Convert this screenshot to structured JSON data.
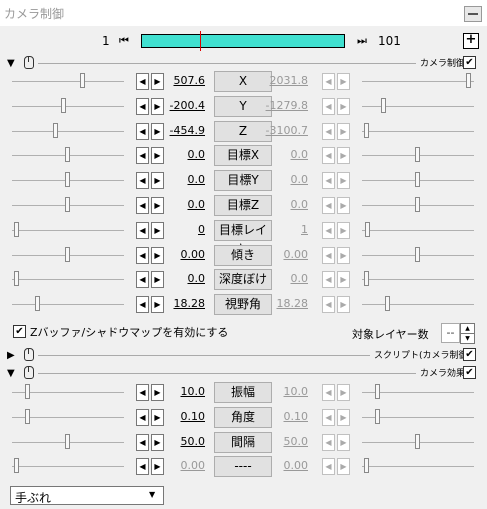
{
  "window": {
    "title": "カメラ制御",
    "minimize_icon": "minimize-icon"
  },
  "frame": {
    "start": "1",
    "end": "101",
    "first_icon": "skip-first-icon",
    "last_icon": "skip-last-icon",
    "add_label": "+"
  },
  "sections": {
    "camera_control": {
      "label": "カメラ制御",
      "checked": true
    },
    "script": {
      "label": "スクリプト(カメラ制御)",
      "checked": true
    },
    "camera_effect": {
      "label": "カメラ効果",
      "checked": true
    }
  },
  "arrows": {
    "left": "◀",
    "right": "▶"
  },
  "camera_params": [
    {
      "name": "X",
      "value": "507.6",
      "end_value": "2031.8",
      "left_pos": 0.64,
      "right_pos": 0.98
    },
    {
      "name": "Y",
      "value": "-200.4",
      "end_value": "-1279.8",
      "left_pos": 0.46,
      "right_pos": 0.18
    },
    {
      "name": "Z",
      "value": "-454.9",
      "end_value": "-3100.7",
      "left_pos": 0.39,
      "right_pos": 0.02
    },
    {
      "name": "目標X",
      "value": "0.0",
      "end_value": "0.0",
      "left_pos": 0.5,
      "right_pos": 0.5
    },
    {
      "name": "目標Y",
      "value": "0.0",
      "end_value": "0.0",
      "left_pos": 0.5,
      "right_pos": 0.5
    },
    {
      "name": "目標Z",
      "value": "0.0",
      "end_value": "0.0",
      "left_pos": 0.5,
      "right_pos": 0.5
    },
    {
      "name": "目標レイヤ",
      "value": "0",
      "end_value": "1",
      "left_pos": 0.02,
      "right_pos": 0.03
    },
    {
      "name": "傾き",
      "value": "0.00",
      "end_value": "0.00",
      "left_pos": 0.5,
      "right_pos": 0.5
    },
    {
      "name": "深度ぼけ",
      "value": "0.0",
      "end_value": "0.0",
      "left_pos": 0.02,
      "right_pos": 0.02
    },
    {
      "name": "視野角",
      "value": "18.28",
      "end_value": "18.28",
      "left_pos": 0.22,
      "right_pos": 0.22
    }
  ],
  "option": {
    "label": "Zバッファ/シャドウマップを有効にする",
    "checked": true
  },
  "target_layer": {
    "label": "対象レイヤー数",
    "value": "--"
  },
  "effect_params": [
    {
      "name": "振幅",
      "value": "10.0",
      "end_value": "10.0",
      "left_pos": 0.12,
      "right_pos": 0.12
    },
    {
      "name": "角度",
      "value": "0.10",
      "end_value": "0.10",
      "left_pos": 0.12,
      "right_pos": 0.12
    },
    {
      "name": "間隔",
      "value": "50.0",
      "end_value": "50.0",
      "left_pos": 0.5,
      "right_pos": 0.5
    },
    {
      "name": "----",
      "value": "0.00",
      "end_value": "0.00",
      "left_pos": 0.02,
      "right_pos": 0.02,
      "disabled": true
    }
  ],
  "effect_select": {
    "value": "手ぶれ"
  }
}
